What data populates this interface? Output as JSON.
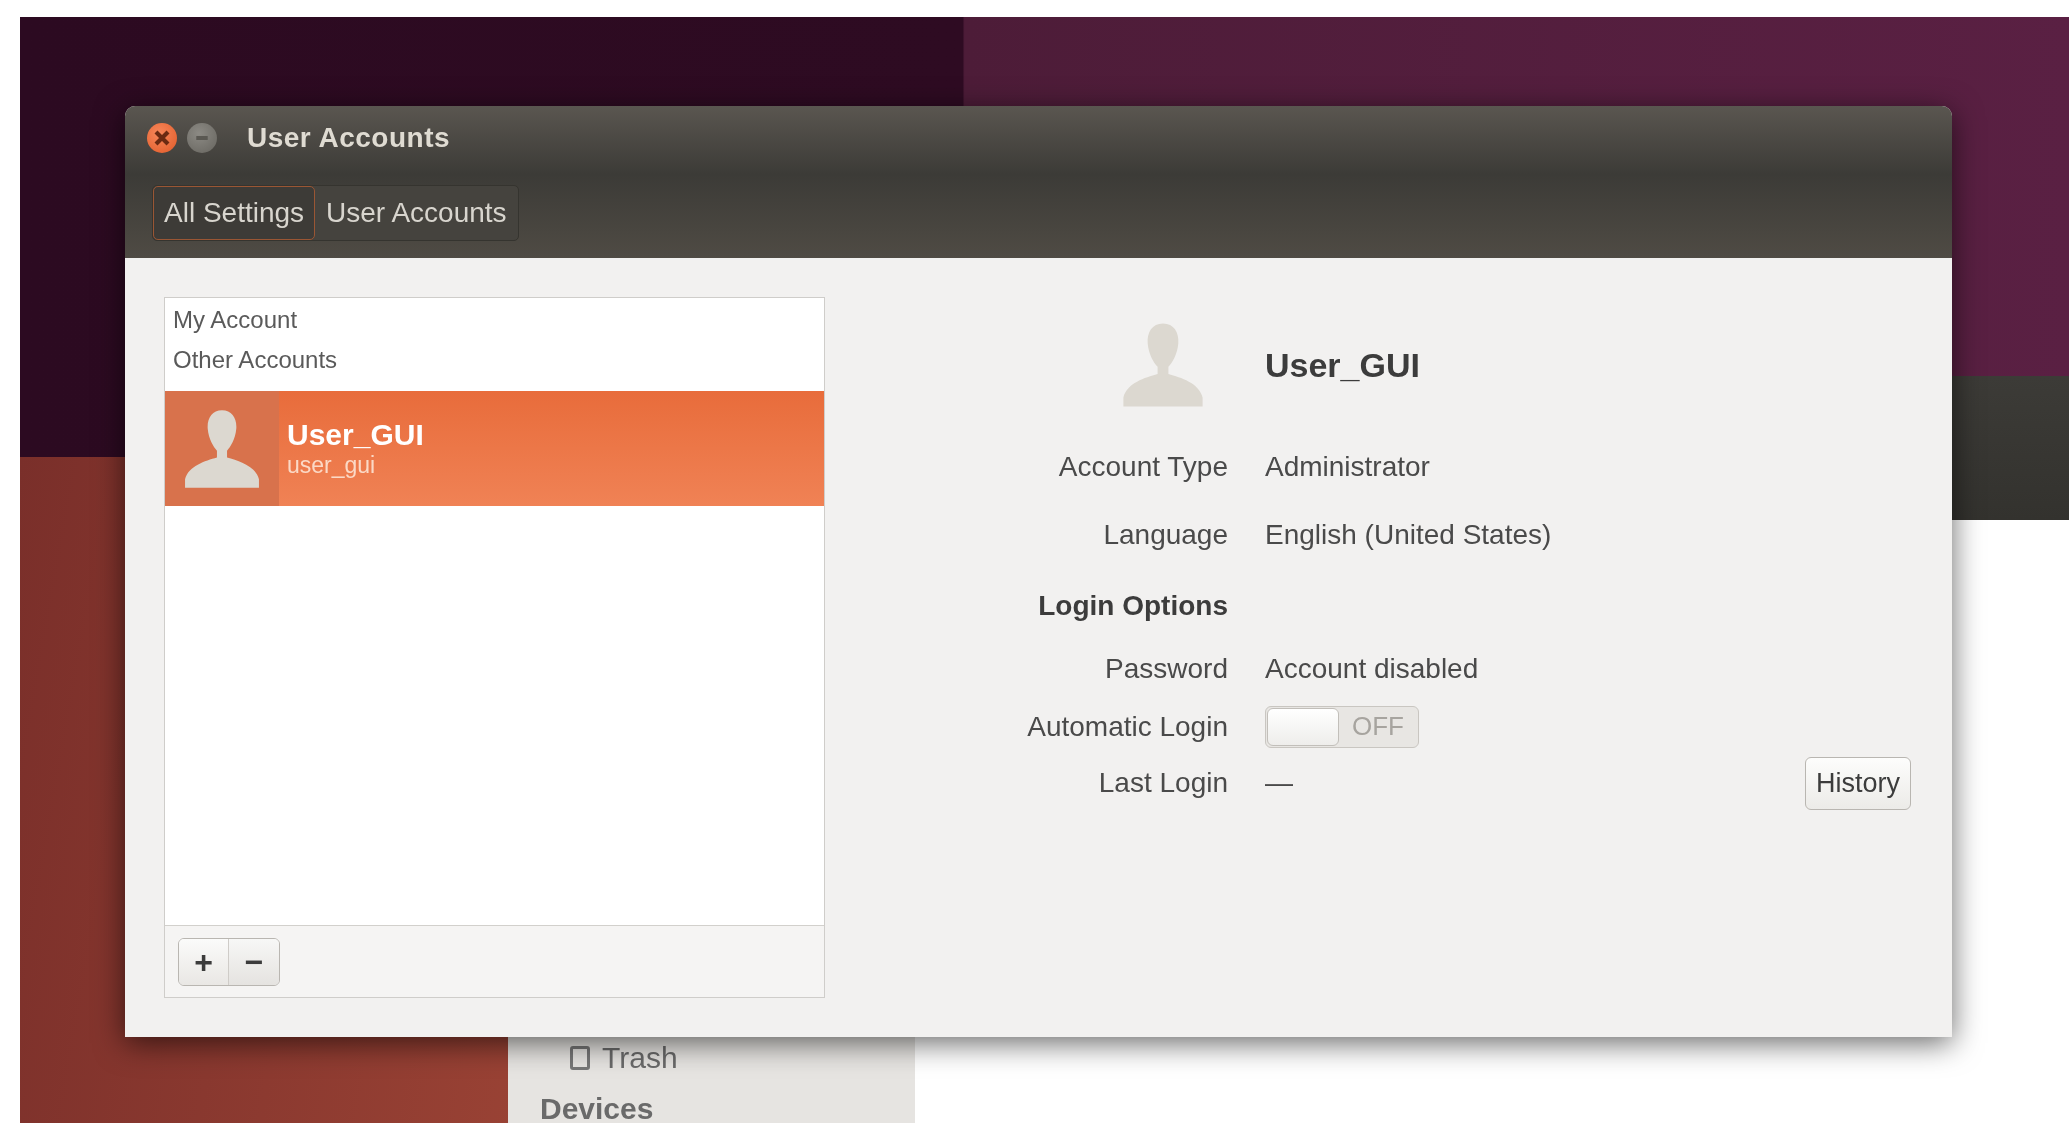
{
  "background_window": {
    "sidebar": [
      {
        "kind": "item",
        "label": "Trash"
      },
      {
        "kind": "heading",
        "label": "Devices"
      }
    ]
  },
  "window": {
    "title": "User Accounts",
    "controls": [
      {
        "kind": "close"
      },
      {
        "kind": "minimize"
      }
    ]
  },
  "breadcrumbs": [
    {
      "label": "All Settings",
      "selected": true
    },
    {
      "label": "User Accounts",
      "selected": false
    }
  ],
  "account_list": {
    "my_account_heading": "My Account",
    "other_accounts_heading": "Other Accounts",
    "items": [
      {
        "name": "User_GUI",
        "username": "user_gui",
        "selected": true
      }
    ],
    "buttons": [
      {
        "kind": "add",
        "label": "+"
      },
      {
        "kind": "remove",
        "label": "−"
      }
    ]
  },
  "details": {
    "name": "User_GUI",
    "fields": [
      {
        "kind": "text",
        "label": "Account Type",
        "value": "Administrator"
      },
      {
        "kind": "text",
        "label": "Language",
        "value": "English (United States)"
      },
      {
        "kind": "heading",
        "label": "Login Options"
      },
      {
        "kind": "text",
        "label": "Password",
        "value": "Account disabled"
      },
      {
        "kind": "switch",
        "label": "Automatic Login",
        "on": false,
        "state_label": "OFF"
      },
      {
        "kind": "text",
        "label": "Last Login",
        "value": "—",
        "button": "History"
      }
    ]
  }
}
